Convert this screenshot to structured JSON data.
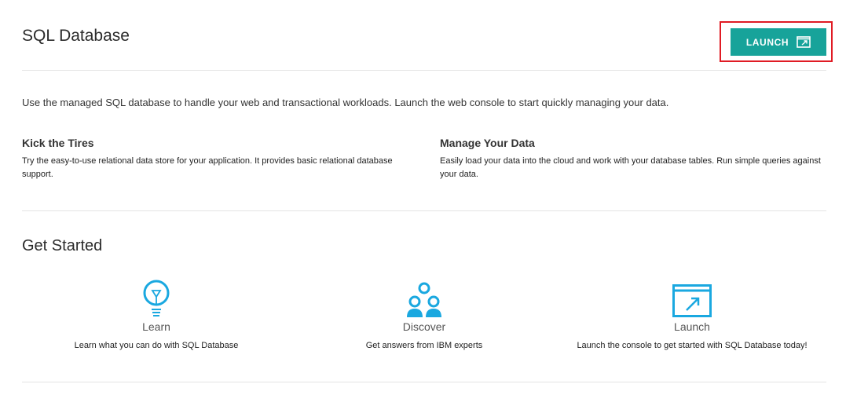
{
  "header": {
    "title": "SQL Database",
    "launch_label": "LAUNCH"
  },
  "intro": "Use the managed SQL database to handle your web and transactional workloads. Launch the web console to start quickly managing your data.",
  "features": [
    {
      "title": "Kick the Tires",
      "description": "Try the easy-to-use relational data store for your application. It provides basic relational database support."
    },
    {
      "title": "Manage Your Data",
      "description": "Easily load your data into the cloud and work with your database tables. Run simple queries against your data."
    }
  ],
  "get_started": {
    "title": "Get Started",
    "cards": [
      {
        "icon": "lightbulb-icon",
        "title": "Learn",
        "description": "Learn what you can do with SQL Database"
      },
      {
        "icon": "people-icon",
        "title": "Discover",
        "description": "Get answers from IBM experts"
      },
      {
        "icon": "launch-window-icon",
        "title": "Launch",
        "description": "Launch the console to get started with SQL Database today!"
      }
    ]
  },
  "colors": {
    "accent": "#17a39a",
    "icon_blue": "#1aa8e0",
    "highlight_red": "#e01b24"
  }
}
